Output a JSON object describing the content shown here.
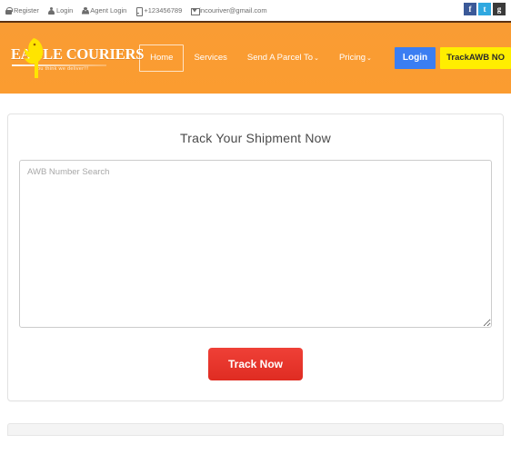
{
  "topbar": {
    "links": [
      {
        "icon": "lock-icon",
        "label": "Register"
      },
      {
        "icon": "user-icon",
        "label": "Login"
      },
      {
        "icon": "agent-icon",
        "label": "Agent Login"
      },
      {
        "icon": "mobile-phone-icon",
        "label": "+123456789"
      },
      {
        "icon": "envelope-icon",
        "label": "incouriver@gmail.com"
      }
    ],
    "social": [
      {
        "name": "facebook-icon",
        "glyph": "f",
        "color": "#3b5998"
      },
      {
        "name": "twitter-icon",
        "glyph": "t",
        "color": "#2fa8e0"
      },
      {
        "name": "google-plus-icon",
        "glyph": "g",
        "color": "#3a3a3a"
      }
    ]
  },
  "header": {
    "logo_text": "EAGLE COURIERS",
    "logo_tagline": "you think we deliver!!!",
    "background_color": "#f89b35",
    "nav": [
      {
        "label": "Home",
        "active": true,
        "caret": ""
      },
      {
        "label": "Services",
        "active": false,
        "caret": ""
      },
      {
        "label": "Send A Parcel To",
        "active": false,
        "caret": "⌄"
      },
      {
        "label": "Pricing",
        "active": false,
        "caret": "⌄"
      }
    ],
    "login_button": "Login",
    "login_button_color": "#3b7ef2",
    "track_awb_button": "TrackAWB NO",
    "track_awb_button_color": "#ffee00"
  },
  "main": {
    "title": "Track Your Shipment Now",
    "search_placeholder": "AWB Number Search",
    "search_value": "",
    "track_button": "Track Now",
    "track_button_color": "#e8342b"
  }
}
